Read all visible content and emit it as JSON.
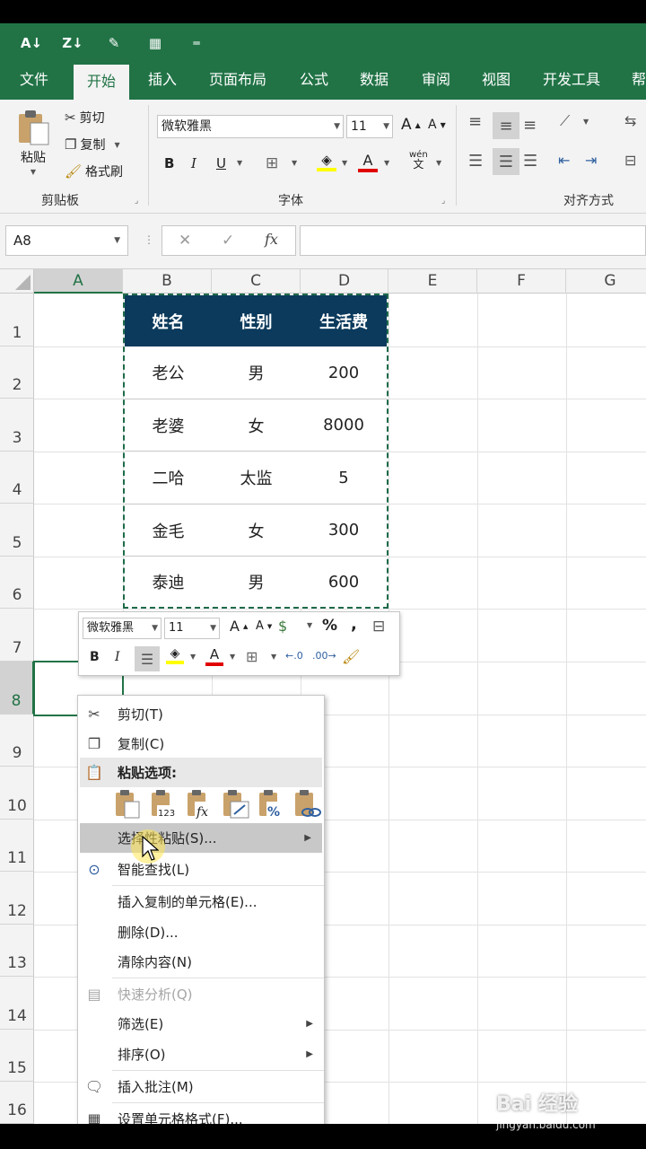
{
  "ribbon": {
    "tabs": [
      "文件",
      "开始",
      "插入",
      "页面布局",
      "公式",
      "数据",
      "审阅",
      "视图",
      "开发工具",
      "帮"
    ],
    "active_tab": "开始",
    "clipboard": {
      "paste": "粘贴",
      "cut": "剪切",
      "copy": "复制",
      "format_painter": "格式刷",
      "group_label": "剪贴板"
    },
    "font": {
      "name": "微软雅黑",
      "size": "11",
      "bold": "B",
      "italic": "I",
      "underline": "U",
      "phonetic_label": "wén",
      "phonetic_char": "文",
      "group_label": "字体"
    },
    "alignment": {
      "group_label": "对齐方式"
    }
  },
  "formula_bar": {
    "name_box": "A8",
    "fx": "fx",
    "value": ""
  },
  "sheet": {
    "columns": [
      "A",
      "B",
      "C",
      "D",
      "E",
      "F",
      "G"
    ],
    "selected_column": "A",
    "rows": [
      "1",
      "2",
      "3",
      "4",
      "5",
      "6",
      "7",
      "8",
      "9",
      "10",
      "11",
      "12",
      "13",
      "14",
      "15",
      "16"
    ],
    "selected_row": "8"
  },
  "table": {
    "headers": [
      "姓名",
      "性别",
      "生活费"
    ],
    "rows": [
      [
        "老公",
        "男",
        "200"
      ],
      [
        "老婆",
        "女",
        "8000"
      ],
      [
        "二哈",
        "太监",
        "5"
      ],
      [
        "金毛",
        "女",
        "300"
      ],
      [
        "泰迪",
        "男",
        "600"
      ]
    ],
    "header_bg": "#0b3a5c"
  },
  "mini_toolbar": {
    "font_name": "微软雅黑",
    "font_size": "11",
    "percent": "%",
    "comma": ",",
    "bold": "B",
    "italic": "I"
  },
  "context_menu": {
    "cut": "剪切(T)",
    "copy": "复制(C)",
    "paste_options": "粘贴选项:",
    "paste_special": "选择性粘贴(S)...",
    "smart_lookup": "智能查找(L)",
    "insert_copied": "插入复制的单元格(E)...",
    "delete": "删除(D)...",
    "clear": "清除内容(N)",
    "quick_analysis": "快速分析(Q)",
    "filter": "筛选(E)",
    "sort": "排序(O)",
    "insert_comment": "插入批注(M)",
    "format_cells": "设置单元格格式(F)..."
  },
  "watermark": {
    "text": "Bai 经验",
    "url": "jingyan.baidu.com"
  },
  "colors": {
    "excel_green": "#217346",
    "ribbon_bg": "#f3f3f3"
  }
}
